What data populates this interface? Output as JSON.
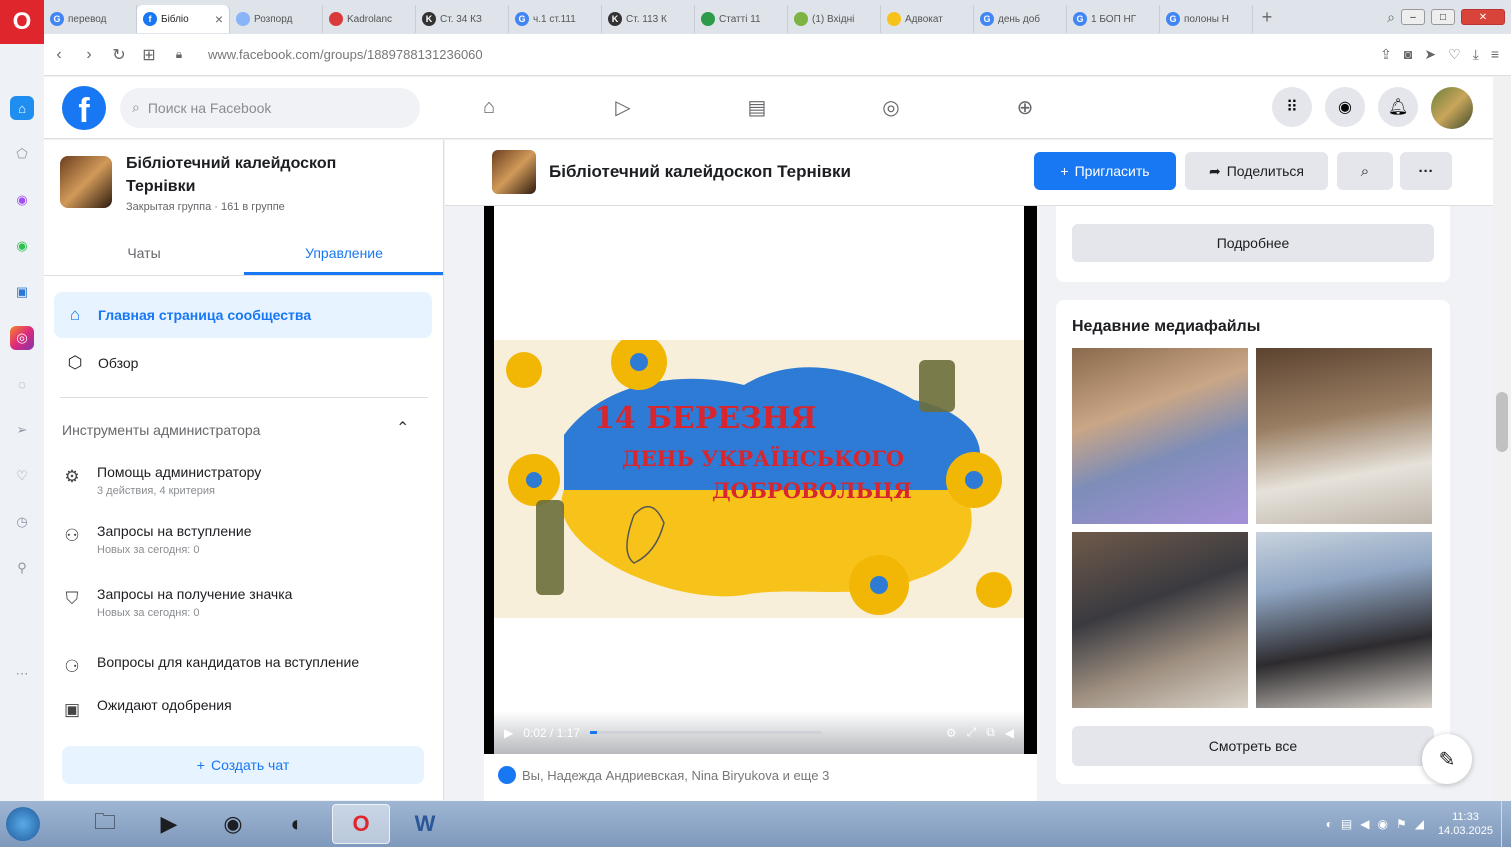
{
  "browser": {
    "tabs": [
      "перевод",
      "Бібліо",
      "Розпорд",
      "Kadrolanc",
      "Ст. 34 КЗ",
      "ч.1 ст.111",
      "Ст. 113 К",
      "Статті 11",
      "(1) Вхідні",
      "Адвокат",
      "день доб",
      "1 БОП НГ",
      "полоны Н"
    ],
    "active_tab_index": 1,
    "url": "www.facebook.com/groups/1889788131236060"
  },
  "facebook": {
    "search_placeholder": "Поиск на Facebook"
  },
  "group": {
    "name": "Бібліотечний калейдоскоп Тернівки",
    "meta": "Закрытая группа · 161 в группе",
    "tabs": [
      "Чаты",
      "Управление"
    ],
    "menu": [
      {
        "label": "Главная страница сообщества",
        "icon": "home-icon"
      },
      {
        "label": "Обзор",
        "icon": "cube-icon"
      }
    ],
    "admin_tools_label": "Инструменты администратора",
    "admin_items": [
      {
        "title": "Помощь администратору",
        "sub": "3 действия, 4 критерия",
        "icon": "admin-assist-icon"
      },
      {
        "title": "Запросы на вступление",
        "sub": "Новых за сегодня: 0",
        "icon": "person-add-icon"
      },
      {
        "title": "Запросы на получение значка",
        "sub": "Новых за сегодня: 0",
        "icon": "badge-icon"
      },
      {
        "title": "Вопросы для кандидатов на вступление",
        "sub": "",
        "icon": "questions-icon"
      },
      {
        "title": "Ожидают одобрения",
        "sub": "",
        "icon": "pending-icon"
      }
    ],
    "create_chat": "Создать чат",
    "invite": "Пригласить",
    "share": "Поделиться"
  },
  "post": {
    "poster_line1": "14 БЕРЕЗНЯ",
    "poster_line2": "ДЕНЬ УКРАЇНСЬКОГО",
    "poster_line3": "ДОБРОВОЛЬЦЯ",
    "video_time": "0:02 / 1:17",
    "video_progress": 0.03,
    "reactions": "Вы, Надежда Андриевская, Nina Biryukova и еще 3"
  },
  "sidebar_right": {
    "more_button": "Подробнее",
    "media_title": "Недавние медиафайлы",
    "see_all": "Смотреть все"
  },
  "taskbar": {
    "time": "11:33",
    "date": "14.03.2025"
  },
  "colors": {
    "fb_blue": "#1877f2",
    "opera_red": "#e0262d",
    "poster_blue": "#2e7bd6",
    "poster_yellow": "#f7c31a",
    "poster_red": "#d7262e"
  }
}
